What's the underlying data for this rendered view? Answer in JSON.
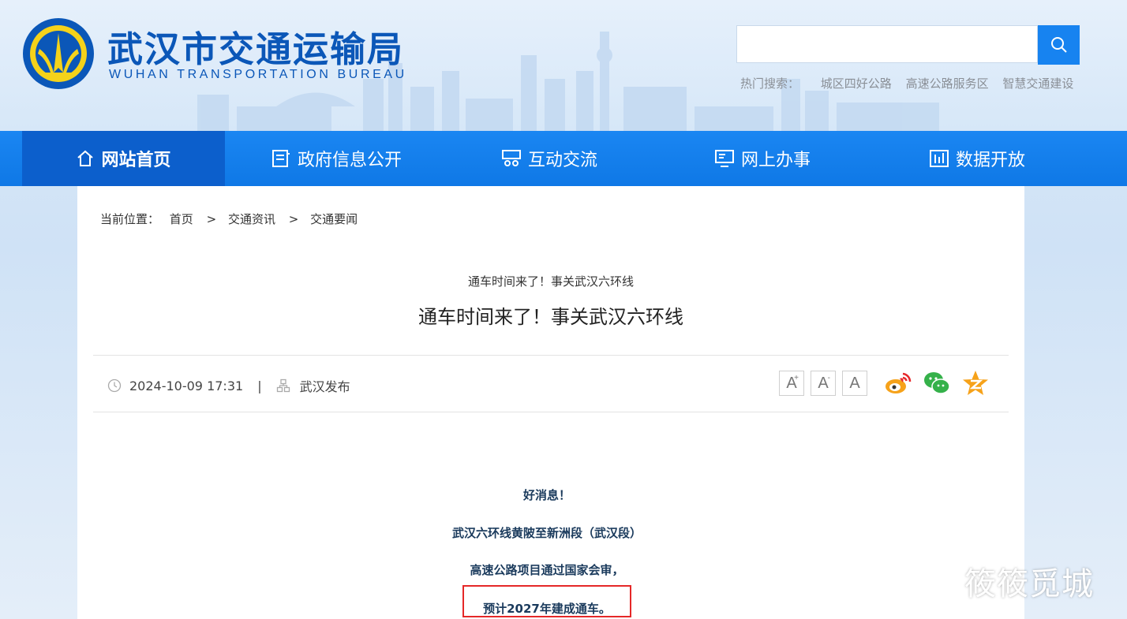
{
  "header": {
    "title": "武汉市交通运输局",
    "subtitle": "WUHAN TRANSPORTATION BUREAU",
    "search_placeholder": "",
    "hot_label": "热门搜索：",
    "hot_items": [
      "城区四好公路",
      "高速公路服务区",
      "智慧交通建设"
    ]
  },
  "nav": {
    "items": [
      {
        "label": "网站首页",
        "icon": "home-icon",
        "active": true
      },
      {
        "label": "政府信息公开",
        "icon": "document-icon"
      },
      {
        "label": "互动交流",
        "icon": "interaction-icon"
      },
      {
        "label": "网上办事",
        "icon": "service-icon"
      },
      {
        "label": "数据开放",
        "icon": "data-icon"
      }
    ]
  },
  "breadcrumb": {
    "label": "当前位置：",
    "items": [
      "首页",
      "交通资讯",
      "交通要闻"
    ],
    "separator": ">"
  },
  "article": {
    "subtitle": "通车时间来了！事关武汉六环线",
    "title": "通车时间来了！事关武汉六环线",
    "date": "2024-10-09 17:31",
    "divider": "|",
    "source": "武汉发布",
    "font_buttons": [
      "A",
      "A",
      "A"
    ],
    "paragraphs": [
      "好消息！",
      "武汉六环线黄陂至新洲段（武汉段）",
      "高速公路项目通过国家会审，",
      "预计2027年建成通车。"
    ]
  },
  "share": [
    "weibo-icon",
    "wechat-icon",
    "qzone-icon"
  ],
  "watermark": "筱筱觅城",
  "colors": {
    "brand_blue": "#0b57b8",
    "nav_blue": "#1783f0",
    "nav_active": "#0c5fcc",
    "highlight_red": "#e52828"
  }
}
